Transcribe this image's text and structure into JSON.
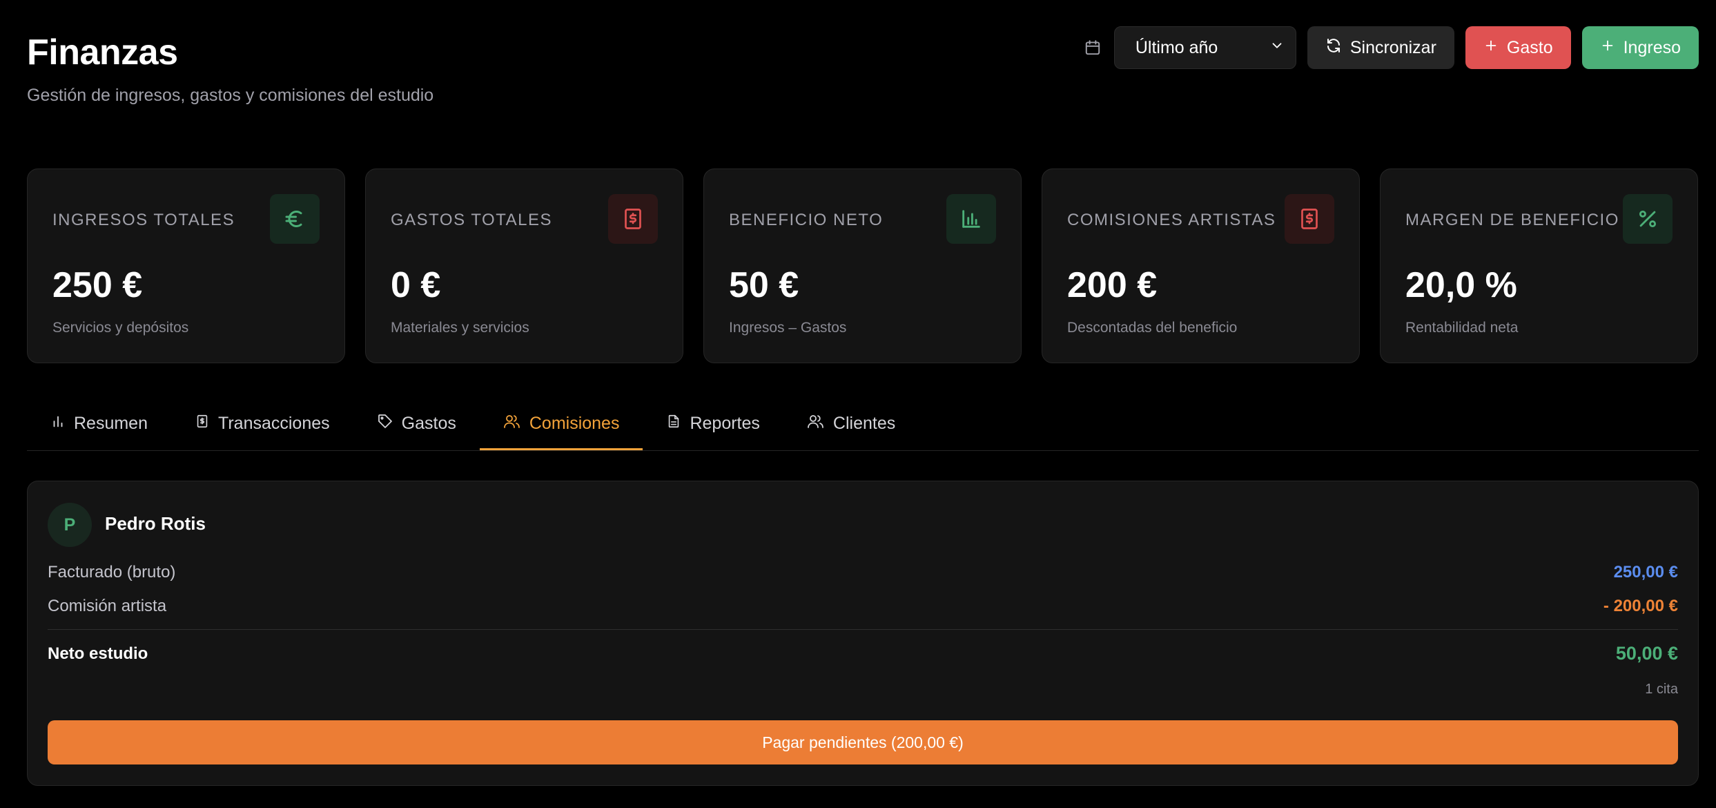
{
  "header": {
    "title": "Finanzas",
    "subtitle": "Gestión de ingresos, gastos y comisiones del estudio"
  },
  "toolbar": {
    "period_icon": "calendar-icon",
    "period_value": "Último año",
    "sync_label": "Sincronizar",
    "gasto_label": "Gasto",
    "ingreso_label": "Ingreso"
  },
  "stats": [
    {
      "label": "INGRESOS TOTALES",
      "value": "250 €",
      "sub": "Servicios y depósitos",
      "icon": "euro-icon",
      "tone": "green"
    },
    {
      "label": "GASTOS TOTALES",
      "value": "0 €",
      "sub": "Materiales y servicios",
      "icon": "receipt-icon",
      "tone": "red"
    },
    {
      "label": "BENEFICIO NETO",
      "value": "50 €",
      "sub": "Ingresos – Gastos",
      "icon": "bar-chart-icon",
      "tone": "green"
    },
    {
      "label": "COMISIONES ARTISTAS",
      "value": "200 €",
      "sub": "Descontadas del beneficio",
      "icon": "receipt-icon",
      "tone": "red"
    },
    {
      "label": "MARGEN DE BENEFICIO",
      "value": "20,0 %",
      "sub": "Rentabilidad neta",
      "icon": "percent-icon",
      "tone": "green"
    }
  ],
  "tabs": [
    {
      "label": "Resumen",
      "icon": "bar-chart-icon",
      "active": false
    },
    {
      "label": "Transacciones",
      "icon": "receipt-icon",
      "active": false
    },
    {
      "label": "Gastos",
      "icon": "tag-icon",
      "active": false
    },
    {
      "label": "Comisiones",
      "icon": "users-icon",
      "active": true
    },
    {
      "label": "Reportes",
      "icon": "file-icon",
      "active": false
    },
    {
      "label": "Clientes",
      "icon": "users-icon",
      "active": false
    }
  ],
  "commission": {
    "avatar_initial": "P",
    "artist_name": "Pedro Rotis",
    "billed_label": "Facturado (bruto)",
    "billed_value": "250,00 €",
    "commission_label": "Comisión artista",
    "commission_value": "- 200,00 €",
    "net_label": "Neto estudio",
    "net_value": "50,00 €",
    "appointments": "1 cita",
    "pay_button": "Pagar pendientes (200,00 €)"
  },
  "colors": {
    "accent": "#f3a33a",
    "green": "#4caf78",
    "red": "#e05252",
    "blue": "#5b8def",
    "orange": "#ec7d35"
  }
}
